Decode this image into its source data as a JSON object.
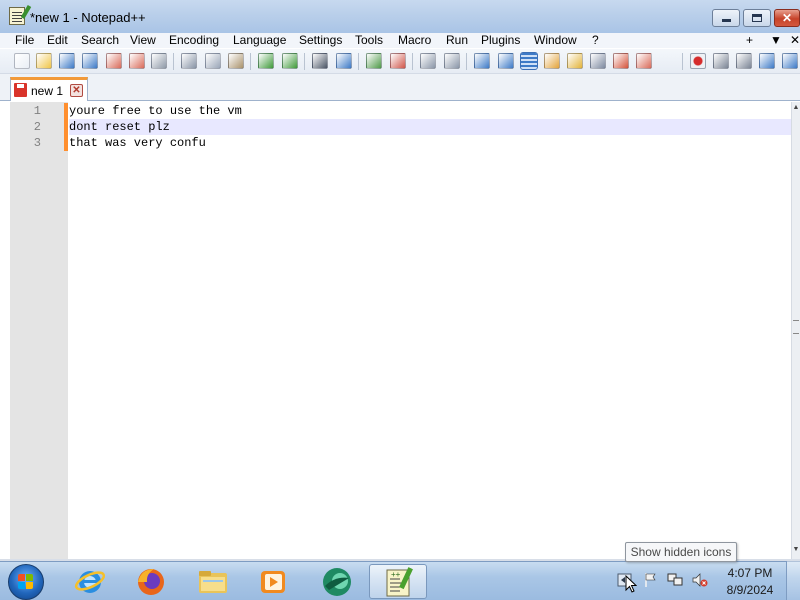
{
  "window": {
    "title": "*new 1 - Notepad++",
    "minimize_glyph": "",
    "maximize_glyph": "",
    "close_glyph": "✕"
  },
  "menu": {
    "items": [
      "File",
      "Edit",
      "Search",
      "View",
      "Encoding",
      "Language",
      "Settings",
      "Tools",
      "Macro",
      "Run",
      "Plugins",
      "Window",
      "?"
    ],
    "right_plus": "+",
    "right_down": "▼",
    "right_close": "✕"
  },
  "toolbar": {
    "icons": [
      "new-file-icon",
      "open-file-icon",
      "save-icon",
      "save-all-icon",
      "close-icon",
      "close-all-icon",
      "print-icon",
      "cut-icon",
      "copy-icon",
      "paste-icon",
      "undo-icon",
      "redo-icon",
      "find-icon",
      "replace-icon",
      "zoom-in-icon",
      "zoom-out-icon",
      "sync-vertical-icon",
      "sync-horizontal-icon",
      "word-wrap-icon",
      "show-all-chars-icon",
      "indent-guide-icon",
      "language-udl-icon",
      "doc-map-icon",
      "function-list-icon",
      "folder-as-workspace-icon",
      "monitoring-icon",
      "record-macro-icon",
      "stop-record-icon",
      "play-macro-icon",
      "run-macro-multiple-icon",
      "save-macro-icon"
    ]
  },
  "tabs": [
    {
      "label": "new 1",
      "close_glyph": "✕"
    }
  ],
  "editor": {
    "lines": [
      {
        "num": "1",
        "text": "youre free to use the vm"
      },
      {
        "num": "2",
        "text": "dont reset plz"
      },
      {
        "num": "3",
        "text": "that was very confu"
      }
    ],
    "current_line": 2
  },
  "tooltip": {
    "text": "Show hidden icons"
  },
  "taskbar": {
    "apps": [
      "internet-explorer-icon",
      "firefox-icon",
      "file-explorer-icon",
      "media-player-icon",
      "browser-green-icon",
      "notepad-plus-plus-icon"
    ],
    "clock_time": "4:07 PM",
    "clock_date": "8/9/2024"
  },
  "colors": {
    "accent_tab": "#f29a3a",
    "change_marker": "#ff8f2e",
    "current_line_bg": "#e8e8ff",
    "gutter_bg": "#e4e4e4"
  }
}
